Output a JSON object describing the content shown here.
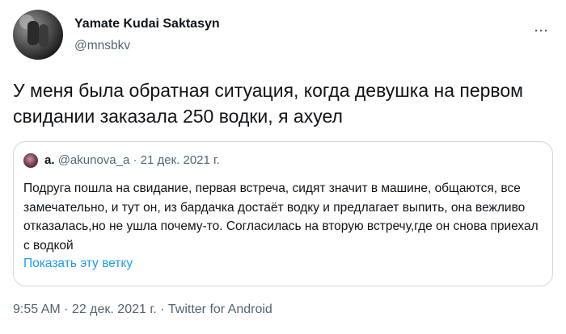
{
  "author": {
    "display_name": "Yamate Kudai Saktasyn",
    "handle": "@mnsbkv"
  },
  "more_menu": "···",
  "tweet_text": "У меня была обратная ситуация, когда девушка на первом свидании заказала 250 водки, я ахуел",
  "quoted_tweet": {
    "display_name": "a.",
    "handle": "@akunova_a",
    "separator": "·",
    "date": "21 дек. 2021 г.",
    "text": "Подруга пошла на свидание, первая встреча, сидят значит в машине, общаются, все замечательно, и тут он, из бардачка достаёт водку и предлагает выпить, она вежливо отказалась,но не ушла почему-то. Согласилась на вторую встречу,где он снова приехал с водкой",
    "show_thread": "Показать эту ветку"
  },
  "footer": "9:55 AM · 22 дек. 2021 г. · Twitter for Android",
  "colors": {
    "text": "#0f1419",
    "secondary": "#536471",
    "link": "#1d9bf0",
    "border": "#cfd9de"
  }
}
